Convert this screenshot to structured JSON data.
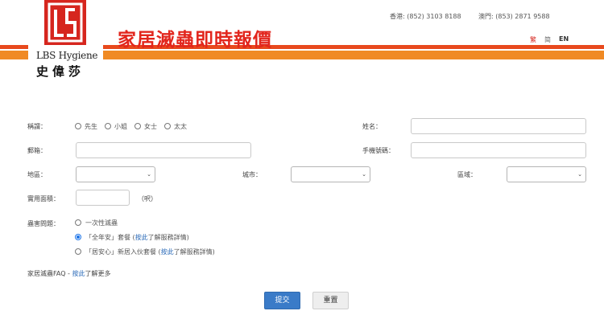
{
  "header": {
    "logo_name": "LBS Hygiene",
    "logo_cn": "史偉莎",
    "title": "家居滅蟲即時報價",
    "contact_hk": "香港: (852) 3103 8188",
    "contact_mo": "澳門: (853) 2871 9588",
    "languages": [
      "繁",
      "简",
      "EN"
    ],
    "brand_color": "#d6261e",
    "stripe_colors": [
      "#e8491d",
      "#f08a24"
    ]
  },
  "form": {
    "salutation_label": "稱謂：",
    "salutations": [
      "先生",
      "小姐",
      "女士",
      "太太"
    ],
    "name_label": "姓名：",
    "email_label": "郵箱：",
    "mobile_label": "手機號碼：",
    "region_label": "地區：",
    "city_label": "城市：",
    "district_label": "區域：",
    "area_label": "實用面積：",
    "area_unit": "（呎）",
    "pest_label": "蟲害問題：",
    "pest_options": [
      {
        "prefix": "一次性滅蟲",
        "link": "",
        "suffix": ""
      },
      {
        "prefix": "「全年安」套餐 (",
        "link": "按此",
        "suffix": "了解服務詳情)"
      },
      {
        "prefix": "「居安心」新居入伙套餐 (",
        "link": "按此",
        "suffix": "了解服務詳情)"
      }
    ],
    "selected_pest_option": 1,
    "faq_prefix": "家居滅蟲FAQ - ",
    "faq_link": "按此",
    "faq_suffix": "了解更多"
  },
  "buttons": {
    "submit": "提交",
    "reset": "重置"
  }
}
